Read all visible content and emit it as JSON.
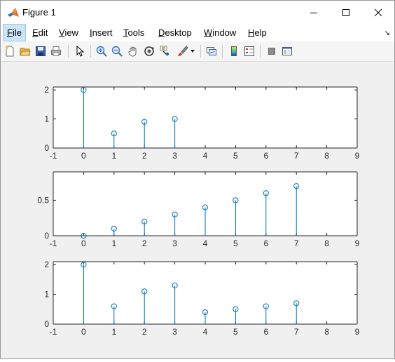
{
  "window": {
    "title": "Figure 1",
    "controls": {
      "minimize": "minimize",
      "maximize": "maximize",
      "close": "close"
    }
  },
  "menubar": {
    "items": [
      {
        "pre": "",
        "u": "F",
        "post": "ile"
      },
      {
        "pre": "",
        "u": "E",
        "post": "dit"
      },
      {
        "pre": "",
        "u": "V",
        "post": "iew"
      },
      {
        "pre": "",
        "u": "I",
        "post": "nsert"
      },
      {
        "pre": "",
        "u": "T",
        "post": "ools"
      },
      {
        "pre": "",
        "u": "D",
        "post": "esktop"
      },
      {
        "pre": "",
        "u": "W",
        "post": "indow"
      },
      {
        "pre": "",
        "u": "H",
        "post": "elp"
      }
    ],
    "overflow_arrow": "↘"
  },
  "toolbar": {
    "icons": [
      "new-figure-icon",
      "open-file-icon",
      "save-icon",
      "print-icon",
      "edit-plot-arrow-icon",
      "zoom-in-icon",
      "zoom-out-icon",
      "pan-hand-icon",
      "rotate-3d-icon",
      "data-cursor-icon",
      "brush-icon",
      "brush-dropdown-icon",
      "link-plot-icon",
      "insert-colorbar-icon",
      "insert-legend-icon",
      "hide-plot-tools-icon",
      "show-plot-tools-icon"
    ]
  },
  "colors": {
    "stem": "#0072bd",
    "axes_bg": "#ffffff",
    "figure_bg": "#f0f0f0"
  },
  "chart_data": [
    {
      "type": "stem",
      "x": [
        0,
        1,
        2,
        3
      ],
      "values": [
        2,
        0.5,
        0.9,
        1
      ],
      "xlim": [
        -1,
        9
      ],
      "ylim": [
        0,
        2.1
      ],
      "xticks": [
        "-1",
        "0",
        "1",
        "2",
        "3",
        "4",
        "5",
        "6",
        "7",
        "8",
        "9"
      ],
      "yticks": [
        "0",
        "1",
        "2"
      ],
      "ytick_values": [
        0,
        1,
        2
      ],
      "grid": false
    },
    {
      "type": "stem",
      "x": [
        0,
        1,
        2,
        3,
        4,
        5,
        6,
        7
      ],
      "values": [
        0,
        0.1,
        0.2,
        0.3,
        0.4,
        0.5,
        0.6,
        0.7
      ],
      "xlim": [
        -1,
        9
      ],
      "ylim": [
        0,
        0.9
      ],
      "xticks": [
        "-1",
        "0",
        "1",
        "2",
        "3",
        "4",
        "5",
        "6",
        "7",
        "8",
        "9"
      ],
      "yticks": [
        "0",
        "0.5"
      ],
      "ytick_values": [
        0,
        0.5
      ],
      "grid": false
    },
    {
      "type": "stem",
      "x": [
        0,
        1,
        2,
        3,
        4,
        5,
        6,
        7
      ],
      "values": [
        2,
        0.6,
        1.1,
        1.3,
        0.4,
        0.5,
        0.6,
        0.7
      ],
      "xlim": [
        -1,
        9
      ],
      "ylim": [
        0,
        2.1
      ],
      "xticks": [
        "-1",
        "0",
        "1",
        "2",
        "3",
        "4",
        "5",
        "6",
        "7",
        "8",
        "9"
      ],
      "yticks": [
        "0",
        "1",
        "2"
      ],
      "ytick_values": [
        0,
        1,
        2
      ],
      "grid": false
    }
  ]
}
